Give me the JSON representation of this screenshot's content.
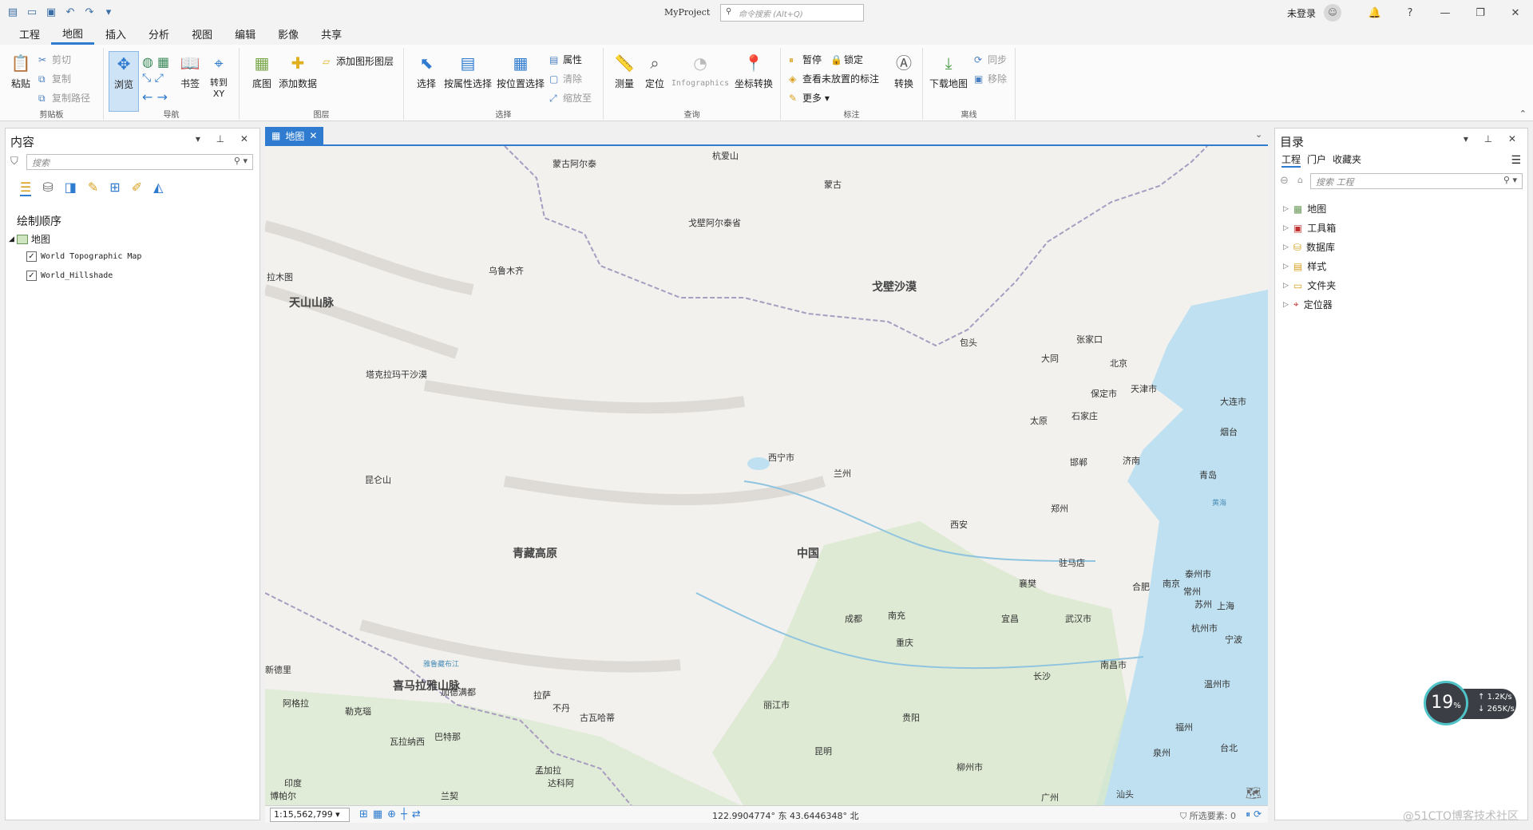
{
  "app": {
    "title": "MyProject",
    "command_search_placeholder": "命令搜索 (Alt+Q)",
    "user": "未登录",
    "help": "?"
  },
  "tabs": [
    "工程",
    "地图",
    "插入",
    "分析",
    "视图",
    "编辑",
    "影像",
    "共享"
  ],
  "active_tab": "地图",
  "ribbon": {
    "clipboard": {
      "name": "剪贴板",
      "paste": "粘贴",
      "cut": "剪切",
      "copy": "复制",
      "copy_path": "复制路径"
    },
    "navigate": {
      "name": "导航",
      "explore": "浏览",
      "bookmarks": "书签",
      "goto": "转到\nXY"
    },
    "layer": {
      "name": "图层",
      "basemap": "底图",
      "add_data": "添加数据",
      "add_graphics": "添加图形图层"
    },
    "selection": {
      "name": "选择",
      "select": "选择",
      "by_attr": "按属性选择",
      "by_loc": "按位置选择",
      "attributes": "属性",
      "clear": "清除",
      "zoom_to": "缩放至"
    },
    "inquiry": {
      "name": "查询",
      "measure": "测量",
      "locate": "定位",
      "infographics": "Infographics",
      "convert_coords": "坐标转换"
    },
    "labeling": {
      "name": "标注",
      "pause": "暂停",
      "lock": "锁定",
      "unplaced": "查看未放置的标注",
      "more": "更多",
      "convert": "转换"
    },
    "offline": {
      "name": "离线",
      "download": "下载地图",
      "sync": "同步",
      "remove": "移除"
    }
  },
  "contents": {
    "title": "内容",
    "search_placeholder": "搜索",
    "drawing_order": "绘制顺序",
    "map_name": "地图",
    "layers": [
      "World Topographic Map",
      "World_Hillshade"
    ]
  },
  "map_tab": "地图",
  "map_labels": {
    "mountains": [
      "杭爱山",
      "蒙古阿尔泰",
      "戈壁阿尔泰省",
      "天山山脉",
      "昆仑山",
      "喜马拉雅山脉",
      "雅鲁藏布江"
    ],
    "regions": [
      "蒙古",
      "戈壁沙漠",
      "塔克拉玛干沙漠",
      "青藏高原",
      "中国",
      "黄海"
    ],
    "cities": [
      "乌鲁木齐",
      "拉木图",
      "包头",
      "张家口",
      "大同",
      "北京",
      "天津市",
      "保定市",
      "大连市",
      "太原",
      "石家庄",
      "烟台",
      "西宁市",
      "兰州",
      "邯郸",
      "济南",
      "青岛",
      "郑州",
      "西安",
      "驻马店",
      "泰州市",
      "襄樊",
      "合肥",
      "南京",
      "常州",
      "苏州",
      "上海",
      "成都",
      "南充",
      "宜昌",
      "武汉市",
      "杭州市",
      "宁波",
      "重庆",
      "南昌市",
      "长沙",
      "温州市",
      "新德里",
      "加德满都",
      "拉萨",
      "不丹",
      "丽江市",
      "阿格拉",
      "勒克瑙",
      "巴特那",
      "古瓦哈蒂",
      "贵阳",
      "瓦拉纳西",
      "福州",
      "昆明",
      "孟加拉",
      "达科阿",
      "印度",
      "博帕尔",
      "兰契",
      "柳州市",
      "泉州",
      "台北",
      "广州",
      "汕头"
    ]
  },
  "status": {
    "scale": "1:15,562,799",
    "coords": "122.9904774° 东  43.6446348° 北",
    "selected": "所选要素: 0"
  },
  "catalog": {
    "title": "目录",
    "tabs": [
      "工程",
      "门户",
      "收藏夹"
    ],
    "search_placeholder": "搜索 工程",
    "items": [
      "地图",
      "工具箱",
      "数据库",
      "样式",
      "文件夹",
      "定位器"
    ]
  },
  "perf_widget": {
    "cpu": "19",
    "up": "1.2K/s",
    "down": "265K/s"
  },
  "watermark": "@51CTO博客技术社区",
  "colors": {
    "accent": "#2e7bcf",
    "map_land": "#f2f1ee",
    "water": "#bfe0f0",
    "forest": "#cfe5c2"
  }
}
